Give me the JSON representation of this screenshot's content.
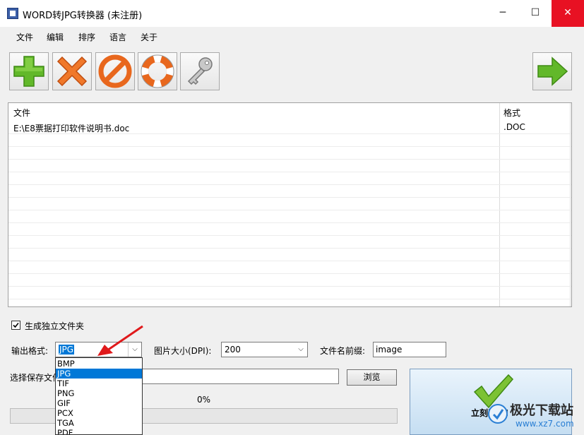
{
  "window": {
    "title": "WORD转JPG转换器 (未注册)",
    "minimize": "─",
    "maximize": "☐",
    "close": "✕"
  },
  "menu": [
    "文件",
    "编辑",
    "排序",
    "语言",
    "关于"
  ],
  "toolbar": {
    "buttons": [
      "add-icon",
      "delete-icon",
      "stop-icon",
      "help-lifebuoy-icon",
      "key-icon"
    ],
    "next": "next-arrow-icon"
  },
  "file_list": {
    "columns": [
      "文件",
      "格式"
    ],
    "rows": [
      {
        "file": "E:\\E8票据打印软件说明书.doc",
        "format": ".DOC"
      }
    ]
  },
  "options": {
    "gen_folder_label": "生成独立文件夹",
    "gen_folder_checked": true,
    "output_format_label": "输出格式:",
    "output_format_value": "JPG",
    "dpi_label": "图片大小(DPI):",
    "dpi_value": "200",
    "prefix_label": "文件名前缀:",
    "prefix_value": "image",
    "save_folder_label": "选择保存文件",
    "browse_label": "浏览",
    "progress_text": "0%",
    "progress": 0,
    "start_label": "立刻开始!"
  },
  "format_options": [
    "BMP",
    "JPG",
    "TIF",
    "PNG",
    "GIF",
    "PCX",
    "TGA",
    "PDF"
  ],
  "format_selected_index": 1,
  "watermark": {
    "text": "极光下载站",
    "url": "www.xz7.com"
  },
  "colors": {
    "selection": "#0078d7",
    "close_hover": "#e81123",
    "arrow": "#e0191b"
  }
}
